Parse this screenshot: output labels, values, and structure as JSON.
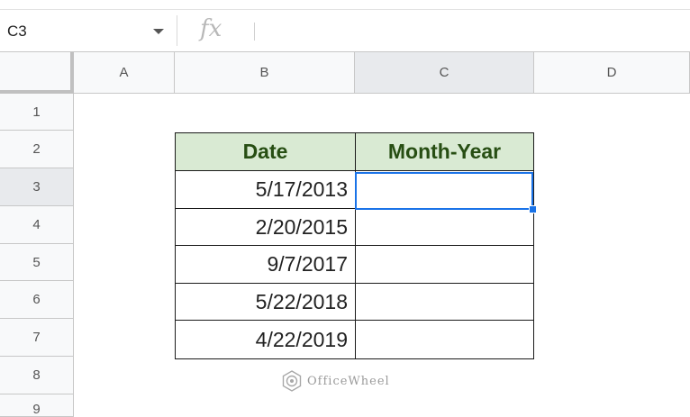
{
  "formula_bar": {
    "name_box": "C3",
    "fx_label": "fx"
  },
  "columns": [
    "A",
    "B",
    "C",
    "D"
  ],
  "rows": [
    "1",
    "2",
    "3",
    "4",
    "5",
    "6",
    "7",
    "8",
    "9"
  ],
  "selected_cell": {
    "column": "C",
    "row": "3"
  },
  "table": {
    "headers": {
      "date": "Date",
      "month_year": "Month-Year"
    },
    "dates": [
      "5/17/2013",
      "2/20/2015",
      "9/7/2017",
      "5/22/2018",
      "4/22/2019"
    ]
  },
  "colors": {
    "header_fill": "#d9ead3",
    "header_text": "#274e13",
    "selection": "#1a73e8"
  },
  "watermark": "OfficeWheel"
}
